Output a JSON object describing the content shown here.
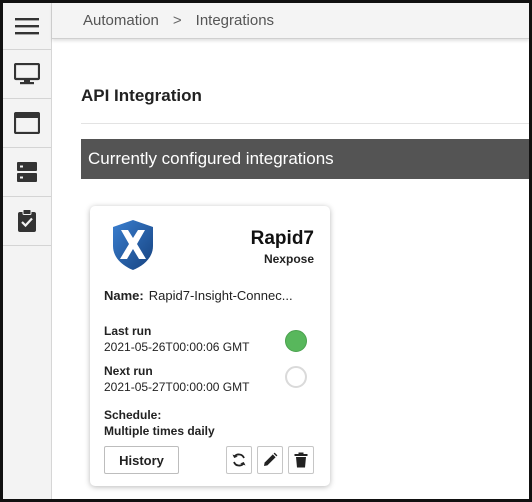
{
  "sidebar": {
    "items": [
      {
        "name": "menu",
        "icon": "hamburger-icon"
      },
      {
        "name": "monitor",
        "icon": "monitor-icon"
      },
      {
        "name": "browser-window",
        "icon": "browser-window-icon"
      },
      {
        "name": "server",
        "icon": "server-icon"
      },
      {
        "name": "clipboard-check",
        "icon": "clipboard-check-icon"
      }
    ]
  },
  "breadcrumb": {
    "items": [
      "Automation",
      "Integrations"
    ],
    "separator": ">"
  },
  "page": {
    "title": "API Integration",
    "section_title": "Currently configured integrations"
  },
  "card": {
    "vendor": "Rapid7",
    "product": "Nexpose",
    "name_label": "Name:",
    "name_value": "Rapid7-Insight-Connec...",
    "last_run_label": "Last run",
    "last_run_value": "2021-05-26T00:00:06 GMT",
    "next_run_label": "Next run",
    "next_run_value": "2021-05-27T00:00:00 GMT",
    "schedule_label": "Schedule:",
    "schedule_value": "Multiple times daily",
    "history_label": "History",
    "actions": [
      "sync-icon",
      "pencil-icon",
      "trash-icon"
    ]
  },
  "colors": {
    "section_bar": "#545454",
    "status_ok": "#58b75c",
    "logo_blue": "#1f5ea8"
  }
}
